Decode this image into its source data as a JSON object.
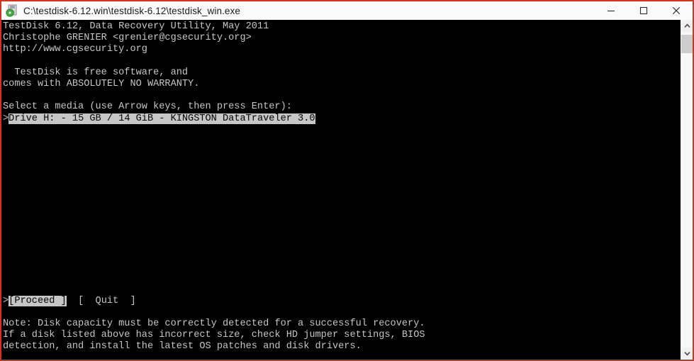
{
  "window": {
    "title": "C:\\testdisk-6.12.win\\testdisk-6.12\\testdisk_win.exe",
    "icon": "testdisk-app-icon",
    "border_color": "#c0392b",
    "titlebar_bg": "#fbfbfb",
    "controls": {
      "minimize": "minimize-icon",
      "maximize": "maximize-icon",
      "close": "close-icon"
    }
  },
  "console": {
    "bg_color": "#000000",
    "fg_color": "#c6c6c6",
    "highlight_bg": "#c6c6c6",
    "highlight_fg": "#000000",
    "header": [
      "TestDisk 6.12, Data Recovery Utility, May 2011",
      "Christophe GRENIER <grenier@cgsecurity.org>",
      "http://www.cgsecurity.org"
    ],
    "license": [
      "  TestDisk is free software, and",
      "comes with ABSOLUTELY NO WARRANTY."
    ],
    "prompt": "Select a media (use Arrow keys, then press Enter):",
    "media_list": [
      {
        "cursor": ">",
        "label": "Drive H: - 15 GB / 14 GiB - KINGSTON DataTraveler 3.0",
        "selected": true
      }
    ],
    "buttons": {
      "cursor": ">",
      "proceed": "[Proceed ]",
      "proceed_selected": true,
      "quit": "[  Quit  ]",
      "quit_selected": false
    },
    "note": [
      "Note: Disk capacity must be correctly detected for a successful recovery.",
      "If a disk listed above has incorrect size, check HD jumper settings, BIOS",
      "detection, and install the latest OS patches and disk drivers."
    ]
  },
  "scrollbar": {
    "up_arrow": "chevron-up-icon",
    "down_arrow": "chevron-down-icon",
    "thumb_position": "top"
  }
}
